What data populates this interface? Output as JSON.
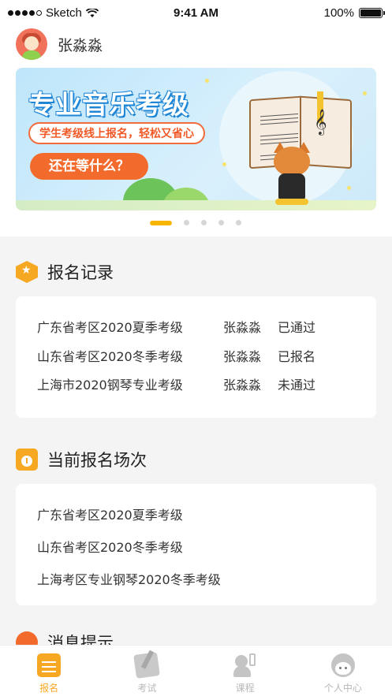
{
  "status_bar": {
    "carrier": "Sketch",
    "time": "9:41 AM",
    "battery": "100%"
  },
  "header": {
    "username": "张淼淼"
  },
  "banner": {
    "title": "专业音乐考级",
    "subtitle": "学生考级线上报名，轻松又省心",
    "cta": "还在等什么？",
    "slide_count": 5,
    "active_slide": 1
  },
  "records": {
    "title": "报名记录",
    "rows": [
      {
        "exam": "广东省考区2020夏季考级",
        "name": "张淼淼",
        "status": "已通过"
      },
      {
        "exam": "山东省考区2020冬季考级",
        "name": "张淼淼",
        "status": "已报名"
      },
      {
        "exam": "上海市2020钢琴专业考级",
        "name": "张淼淼",
        "status": "未通过"
      }
    ]
  },
  "current": {
    "title": "当前报名场次",
    "items": [
      "广东省考区2020夏季考级",
      "山东省考区2020冬季考级",
      "上海考区专业钢琴2020冬季考级"
    ]
  },
  "messages": {
    "title": "消息提示"
  },
  "tabbar": {
    "tabs": [
      {
        "label": "报名",
        "icon": "signup-icon",
        "active": true
      },
      {
        "label": "考试",
        "icon": "exam-icon",
        "active": false
      },
      {
        "label": "课程",
        "icon": "course-icon",
        "active": false
      },
      {
        "label": "个人中心",
        "icon": "profile-icon",
        "active": false
      }
    ]
  },
  "colors": {
    "accent": "#f7a823",
    "cta": "#f26b2c",
    "title_blue": "#1f86d6"
  }
}
